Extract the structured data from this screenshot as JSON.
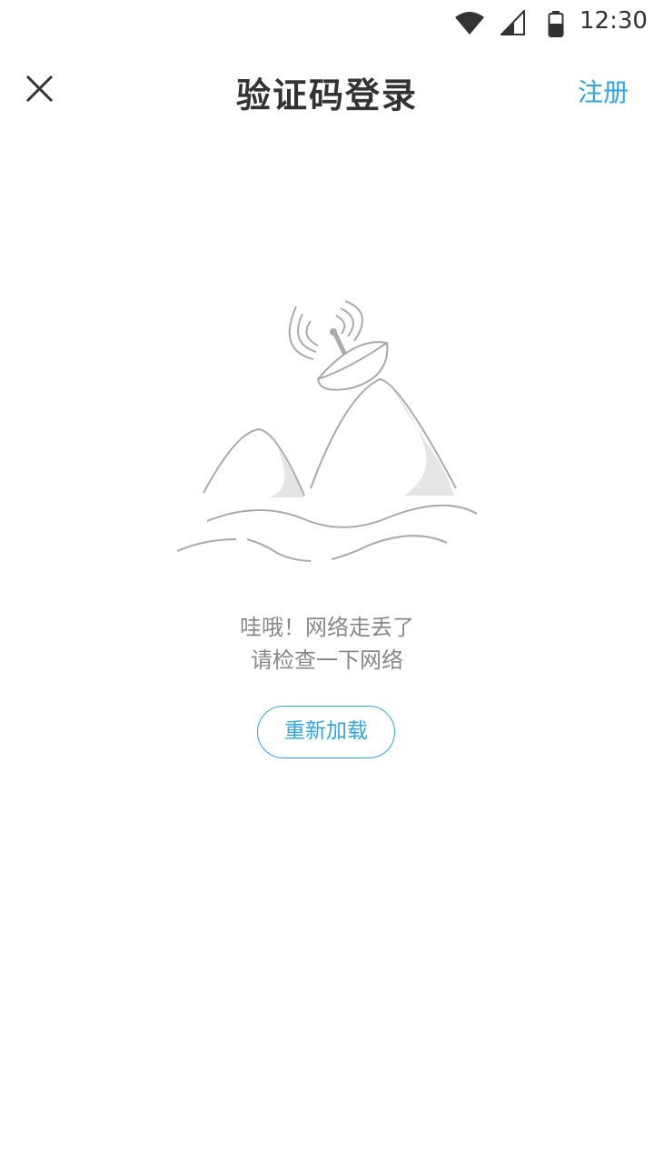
{
  "status_bar": {
    "time": "12:30",
    "icons": [
      "wifi-icon",
      "signal-icon",
      "battery-icon"
    ]
  },
  "header": {
    "close_icon": "close-icon",
    "title": "验证码登录",
    "register_label": "注册"
  },
  "error": {
    "illustration": "satellite-dish-mountains",
    "message_line1": "哇哦！网络走丢了",
    "message_line2": "请检查一下网络",
    "reload_label": "重新加载"
  },
  "colors": {
    "accent": "#2ea6e6",
    "title": "#333333",
    "message": "#888888",
    "illustration_stroke": "#aaaaaa",
    "illustration_fill": "#e5e5e5"
  }
}
